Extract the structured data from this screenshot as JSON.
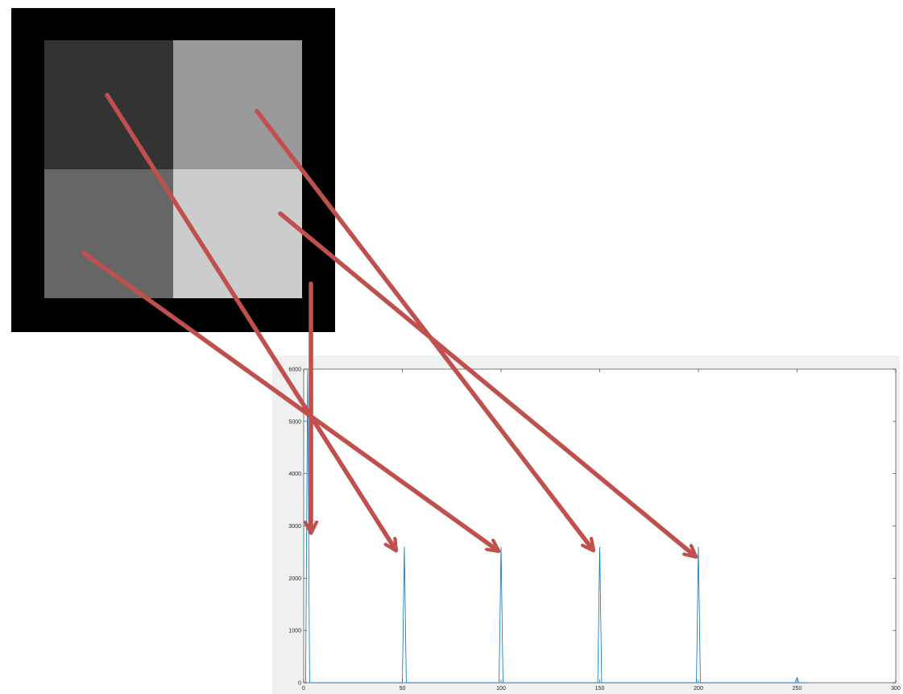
{
  "image": {
    "background": "#000000",
    "quadrants": [
      {
        "name": "top-left",
        "color": "#333333"
      },
      {
        "name": "top-right",
        "color": "#999999"
      },
      {
        "name": "bottom-left",
        "color": "#666666"
      },
      {
        "name": "bottom-right",
        "color": "#cccccc"
      }
    ]
  },
  "arrow_color": "#c0504d",
  "chart_data": {
    "type": "line",
    "title": "",
    "xlabel": "",
    "ylabel": "",
    "xlim": [
      0,
      300
    ],
    "ylim": [
      0,
      6000
    ],
    "x_ticks": [
      "0",
      "50",
      "100",
      "150",
      "200",
      "250",
      "300"
    ],
    "y_ticks": [
      "0",
      "1000",
      "2000",
      "3000",
      "4000",
      "5000",
      "6000"
    ],
    "series": [
      {
        "color": "#0072bd",
        "points": [
          [
            0,
            0
          ],
          [
            1,
            0
          ],
          [
            2,
            6000
          ],
          [
            3,
            0
          ],
          [
            50,
            0
          ],
          [
            51,
            2600
          ],
          [
            52,
            0
          ],
          [
            99,
            0
          ],
          [
            100,
            2600
          ],
          [
            101,
            0
          ],
          [
            149,
            0
          ],
          [
            150,
            2600
          ],
          [
            151,
            0
          ],
          [
            199,
            0
          ],
          [
            200,
            2600
          ],
          [
            201,
            0
          ],
          [
            249,
            0
          ],
          [
            250,
            100
          ],
          [
            251,
            0
          ],
          [
            255,
            0
          ]
        ]
      }
    ],
    "grid": false
  }
}
